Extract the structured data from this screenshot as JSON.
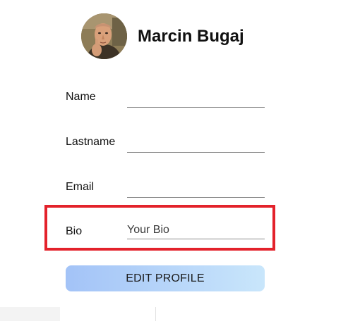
{
  "profile": {
    "name": "Marcin Bugaj",
    "avatar_alt": "Profile photo"
  },
  "form": {
    "fields": [
      {
        "label": "Name",
        "value": "",
        "placeholder": ""
      },
      {
        "label": "Lastname",
        "value": "",
        "placeholder": ""
      },
      {
        "label": "Email",
        "value": "",
        "placeholder": ""
      },
      {
        "label": "Bio",
        "value": "",
        "placeholder": "Your Bio"
      }
    ],
    "submit_label": "EDIT PROFILE"
  },
  "colors": {
    "highlight": "#e3222b",
    "button_gradient_start": "#a3c3f7",
    "button_gradient_end": "#c9e6fb"
  }
}
